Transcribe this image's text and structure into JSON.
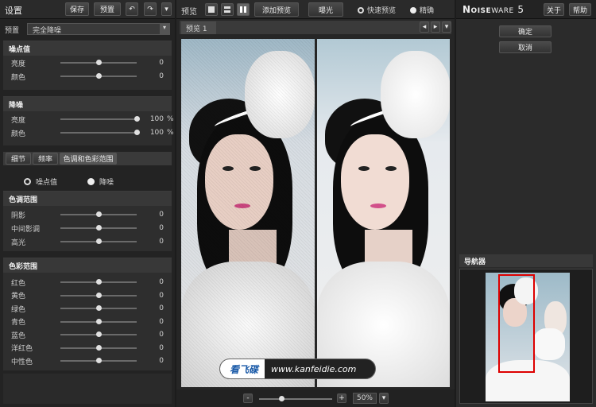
{
  "left_toolbar": {
    "title": "设置",
    "save": "保存",
    "presets": "预置"
  },
  "preset": {
    "label": "预置",
    "value": "完全降噪"
  },
  "noise_level": {
    "title": "噪点值",
    "rows": [
      {
        "label": "亮度",
        "value": "0",
        "level": 0.5
      },
      {
        "label": "颜色",
        "value": "0",
        "level": 0.5
      }
    ]
  },
  "noise_reduction": {
    "title": "降噪",
    "rows": [
      {
        "label": "亮度",
        "value": "100",
        "unit": "%",
        "level": 1.0
      },
      {
        "label": "颜色",
        "value": "100",
        "unit": "%",
        "level": 1.0
      }
    ]
  },
  "tabs": [
    "细节",
    "频率",
    "色调和色彩范围"
  ],
  "radios": {
    "noise": "噪点值",
    "reduce": "降噪"
  },
  "tone_range": {
    "title": "色调范围",
    "rows": [
      {
        "label": "阴影",
        "value": "0",
        "level": 0.5
      },
      {
        "label": "中间影调",
        "value": "0",
        "level": 0.5
      },
      {
        "label": "高光",
        "value": "0",
        "level": 0.5
      }
    ]
  },
  "color_range": {
    "title": "色彩范围",
    "rows": [
      {
        "label": "红色",
        "value": "0",
        "level": 0.5
      },
      {
        "label": "黄色",
        "value": "0",
        "level": 0.5
      },
      {
        "label": "绿色",
        "value": "0",
        "level": 0.5
      },
      {
        "label": "青色",
        "value": "0",
        "level": 0.5
      },
      {
        "label": "蓝色",
        "value": "0",
        "level": 0.5
      },
      {
        "label": "洋红色",
        "value": "0",
        "level": 0.5
      },
      {
        "label": "中性色",
        "value": "0",
        "level": 0.5
      }
    ]
  },
  "preview_bar": {
    "label": "预览",
    "add_preview": "添加预览",
    "exposure": "曝光",
    "fast_preview": "快速预览",
    "accurate": "精确"
  },
  "preview_tab": "预览 1",
  "watermark": {
    "brand": "看飞碟",
    "url": "www.kanfeidie.com"
  },
  "zoom": {
    "minus": "-",
    "plus": "+",
    "value": "50%",
    "level": 0.3
  },
  "right": {
    "brand_a": "N",
    "brand_b": "OISE",
    "brand_c": "WARE",
    "version": "5",
    "about": "关于",
    "help": "帮助",
    "ok": "确定",
    "cancel": "取消",
    "navigator": "导航器"
  }
}
